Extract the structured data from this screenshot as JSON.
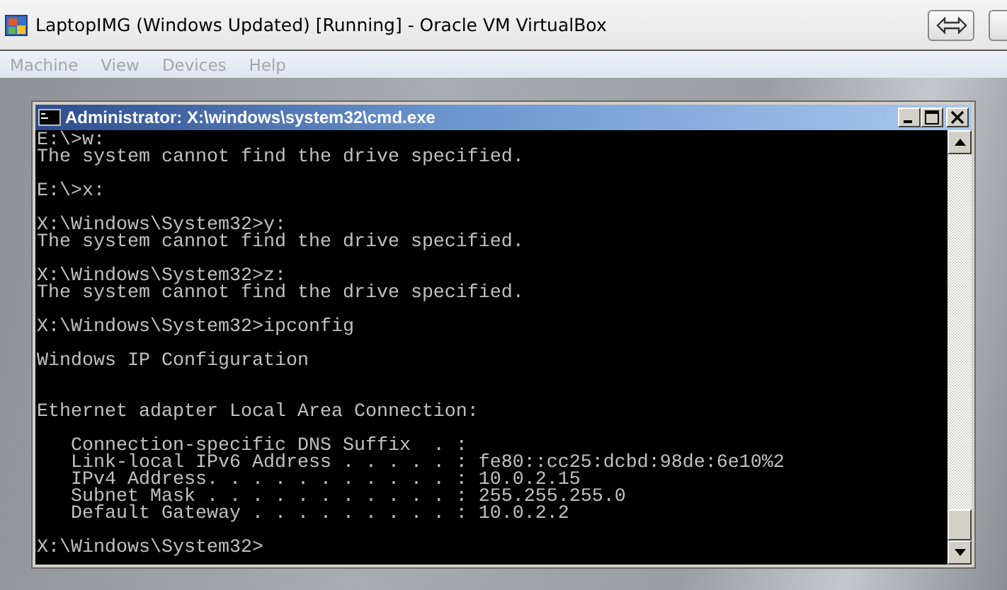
{
  "window": {
    "title": "LaptopIMG (Windows Updated) [Running] - Oracle VM VirtualBox"
  },
  "menu": [
    {
      "label": "Machine",
      "disabled": true
    },
    {
      "label": "View",
      "disabled": true
    },
    {
      "label": "Devices",
      "disabled": true
    },
    {
      "label": "Help",
      "disabled": true
    }
  ],
  "console_window": {
    "title": "Administrator: X:\\windows\\system32\\cmd.exe",
    "paragraphs": [
      {
        "lines": [
          "E:\\>w:",
          "The system cannot find the drive specified."
        ],
        "double_gap": false
      },
      {
        "lines": [
          "E:\\>x:"
        ],
        "double_gap": false
      },
      {
        "lines": [
          "X:\\Windows\\System32>y:",
          "The system cannot find the drive specified."
        ],
        "double_gap": false
      },
      {
        "lines": [
          "X:\\Windows\\System32>z:",
          "The system cannot find the drive specified."
        ],
        "double_gap": false
      },
      {
        "lines": [
          "X:\\Windows\\System32>ipconfig"
        ],
        "double_gap": false
      },
      {
        "lines": [
          "Windows IP Configuration"
        ],
        "double_gap": true
      },
      {
        "lines": [
          "Ethernet adapter Local Area Connection:"
        ],
        "double_gap": false
      },
      {
        "lines": [
          "   Connection-specific DNS Suffix  . :",
          "   Link-local IPv6 Address . . . . . : fe80::cc25:dcbd:98de:6e10%2",
          "   IPv4 Address. . . . . . . . . . . : 10.0.2.15",
          "   Subnet Mask . . . . . . . . . . . : 255.255.255.0",
          "   Default Gateway . . . . . . . . . : 10.0.2.2"
        ],
        "double_gap": false
      },
      {
        "lines": [
          "X:\\Windows\\System32>"
        ],
        "double_gap": false
      }
    ]
  }
}
